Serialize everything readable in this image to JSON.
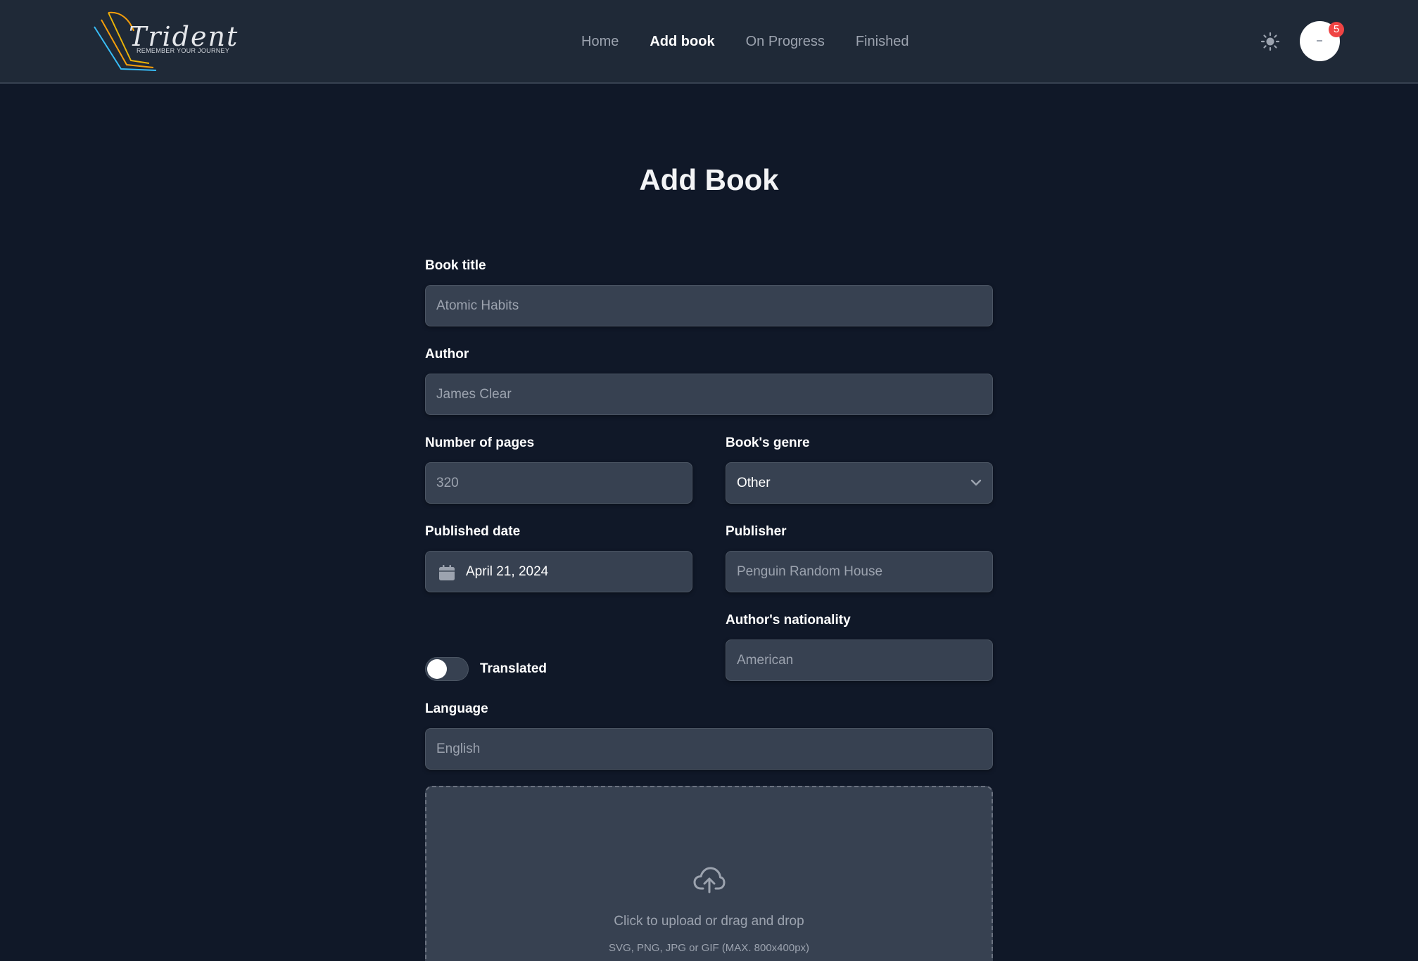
{
  "brand": {
    "name": "Trident",
    "tagline": "REMEMBER YOUR JOURNEY"
  },
  "nav": {
    "links": [
      {
        "label": "Home",
        "active": false
      },
      {
        "label": "Add book",
        "active": true
      },
      {
        "label": "On Progress",
        "active": false
      },
      {
        "label": "Finished",
        "active": false
      }
    ]
  },
  "header": {
    "theme_icon": "sun-icon",
    "notification_count": "5"
  },
  "page": {
    "title": "Add Book"
  },
  "form": {
    "title": {
      "label": "Book title",
      "placeholder": "Atomic Habits"
    },
    "author": {
      "label": "Author",
      "placeholder": "James Clear"
    },
    "pages": {
      "label": "Number of pages",
      "placeholder": "320"
    },
    "genre": {
      "label": "Book's genre",
      "value": "Other"
    },
    "published_date": {
      "label": "Published date",
      "value": "April 21, 2024"
    },
    "publisher": {
      "label": "Publisher",
      "placeholder": "Penguin Random House"
    },
    "nationality": {
      "label": "Author's nationality",
      "placeholder": "American"
    },
    "translated": {
      "label": "Translated",
      "checked": false
    },
    "language": {
      "label": "Language",
      "placeholder": "English"
    },
    "upload": {
      "text": "Click to upload or drag and drop",
      "hint": "SVG, PNG, JPG or GIF (MAX. 800x400px)"
    }
  },
  "colors": {
    "background": "#101828",
    "navbar": "#1f2937",
    "field": "#374151",
    "badge": "#ef4444"
  }
}
